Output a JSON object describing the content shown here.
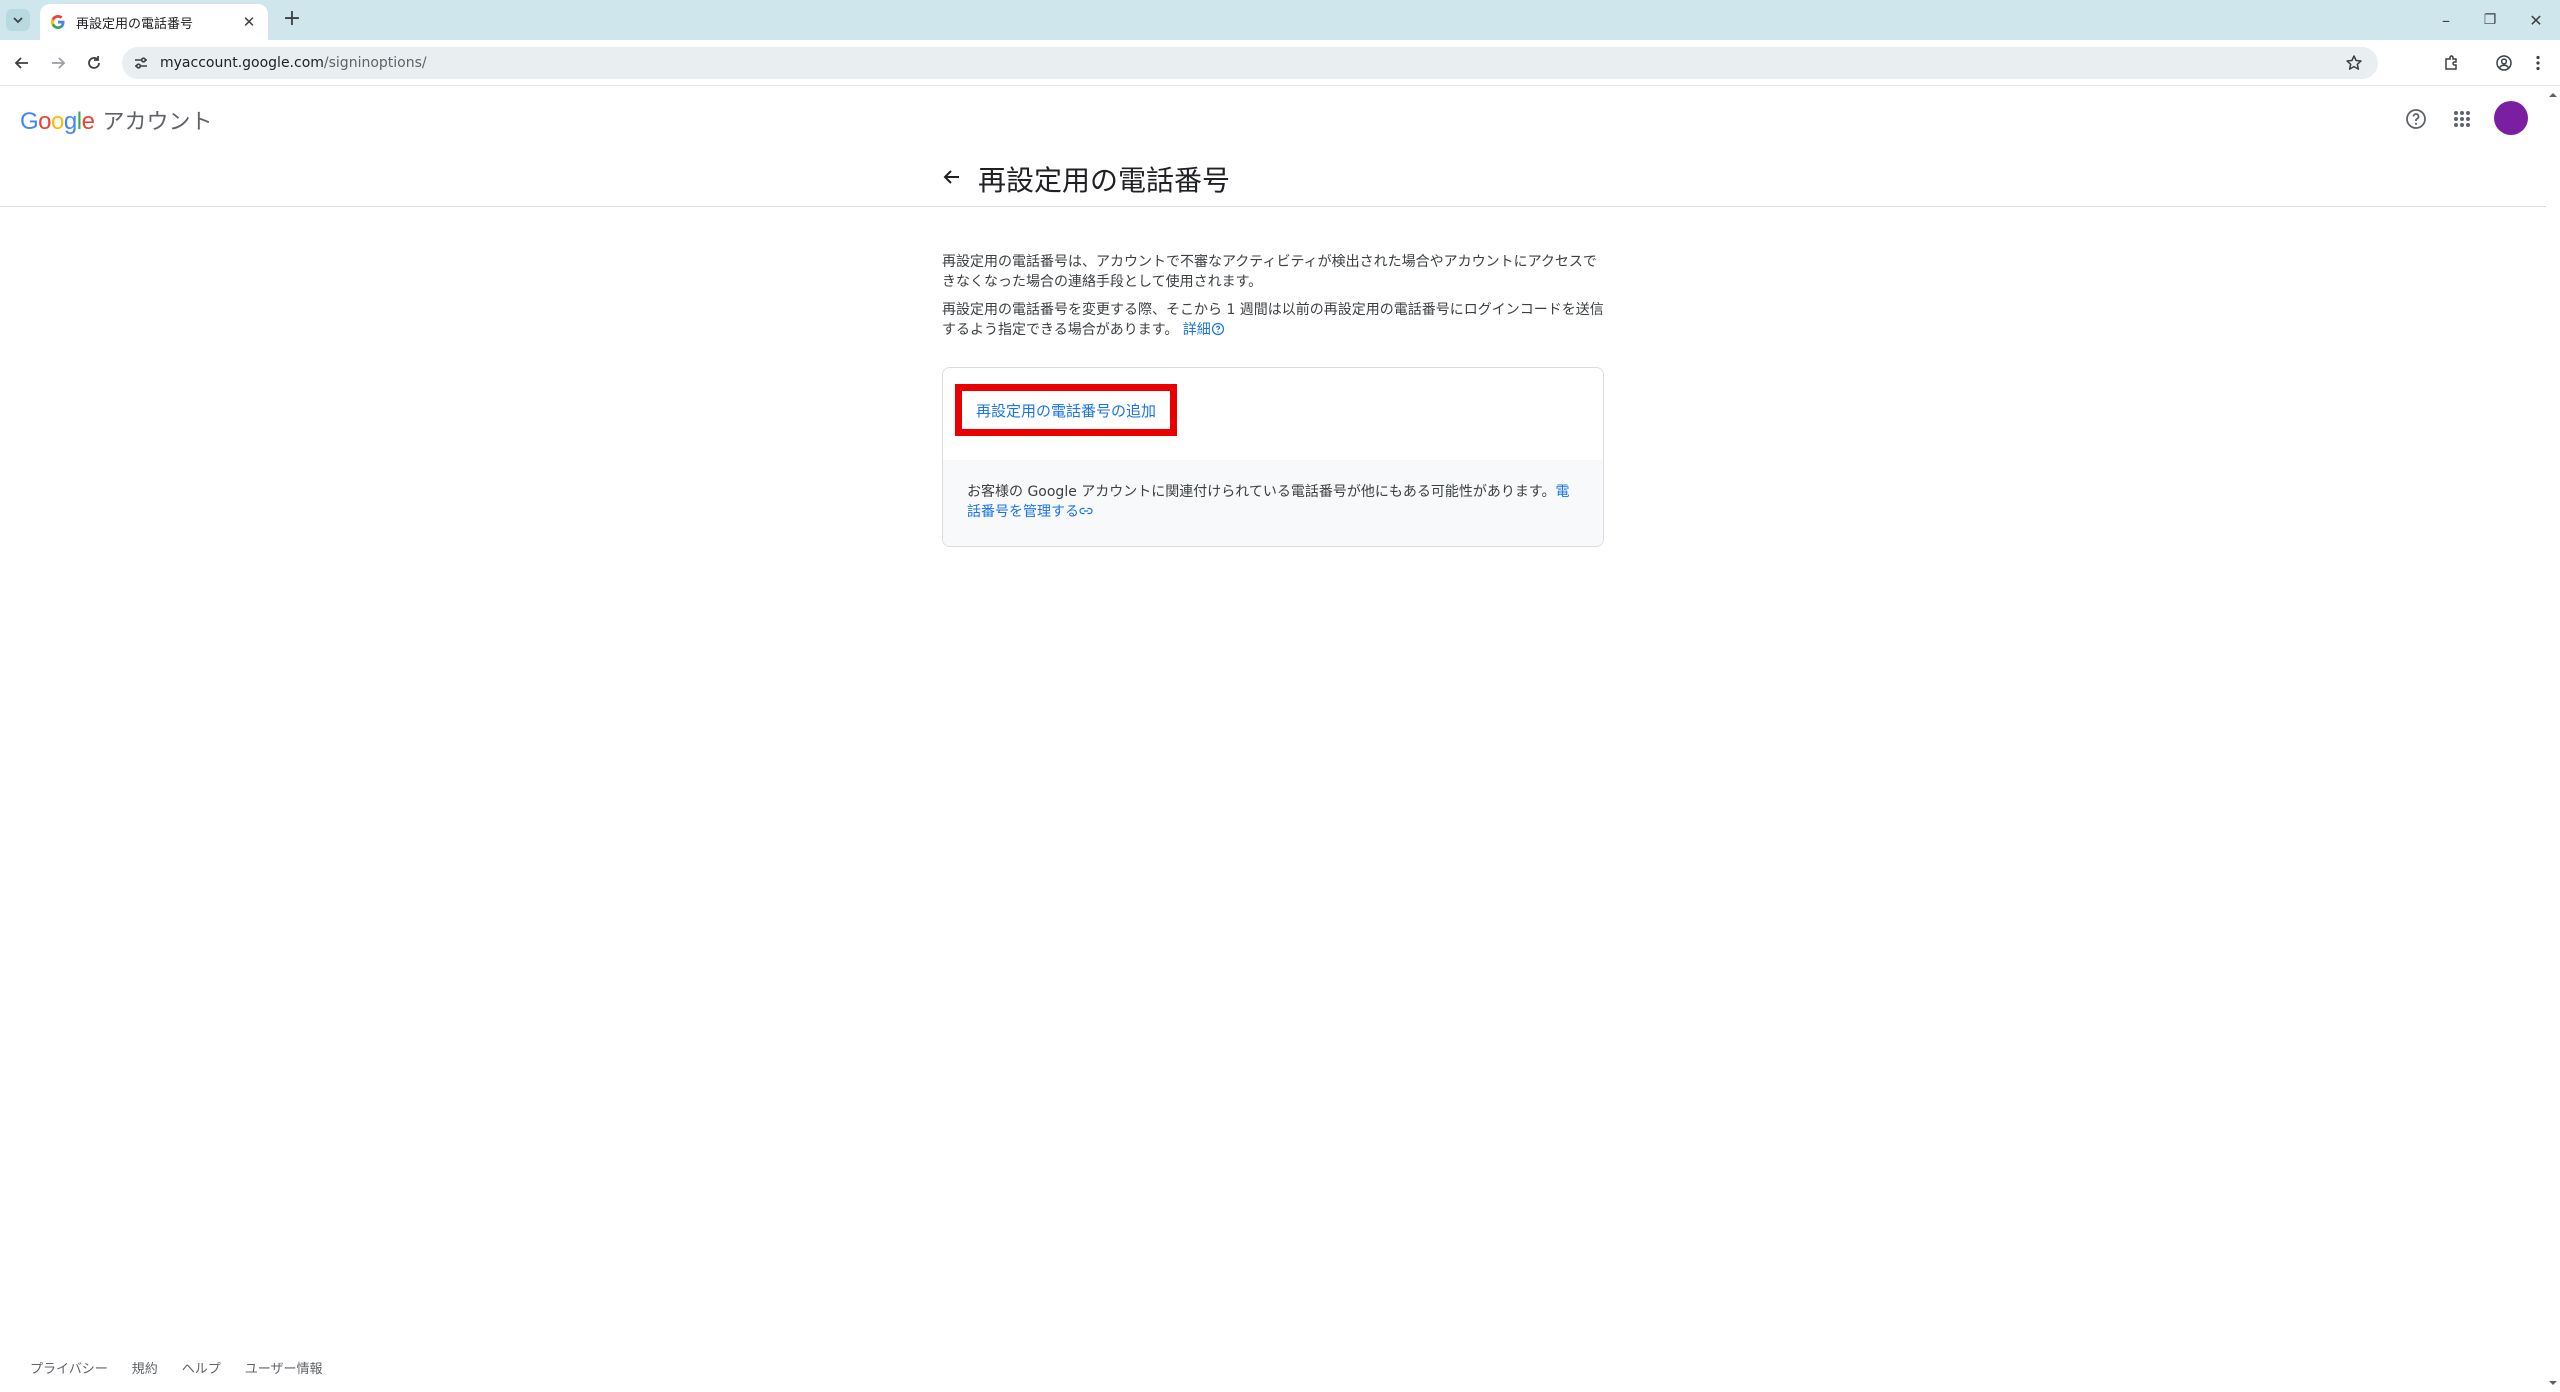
{
  "browser": {
    "tab_title": "再設定用の電話番号",
    "url_host": "myaccount.google.com",
    "url_path": "/signinoptions/",
    "new_tab": "+",
    "close_tab": "✕",
    "minimize": "–",
    "maximize": "❐",
    "close_window": "✕"
  },
  "header": {
    "logo": {
      "G": "G",
      "o1": "o",
      "o2": "o",
      "g": "g",
      "l": "l",
      "e": "e"
    },
    "product_name": "アカウント",
    "avatar_color": "#7b1fa2"
  },
  "page": {
    "title": "再設定用の電話番号",
    "description_1": "再設定用の電話番号は、アカウントで不審なアクティビティが検出された場合やアカウントにアクセスできなくなった場合の連絡手段として使用されます。",
    "description_2": "再設定用の電話番号を変更する際、そこから 1 週間は以前の再設定用の電話番号にログインコードを送信するよう指定できる場合があります。",
    "details_link": "詳細",
    "add_button": "再設定用の電話番号の追加",
    "manage_note": "お客様の Google アカウントに関連付けられている電話番号が他にもある可能性があります。",
    "manage_link": "電話番号を管理する"
  },
  "footer": {
    "links": [
      "プライバシー",
      "規約",
      "ヘルプ",
      "ユーザー情報"
    ]
  },
  "colors": {
    "link": "#1a73e8",
    "highlight_border": "#ea0000",
    "google_blue": "#4285f4",
    "google_red": "#ea4335",
    "google_yellow": "#fbbc05",
    "google_green": "#34a853"
  }
}
